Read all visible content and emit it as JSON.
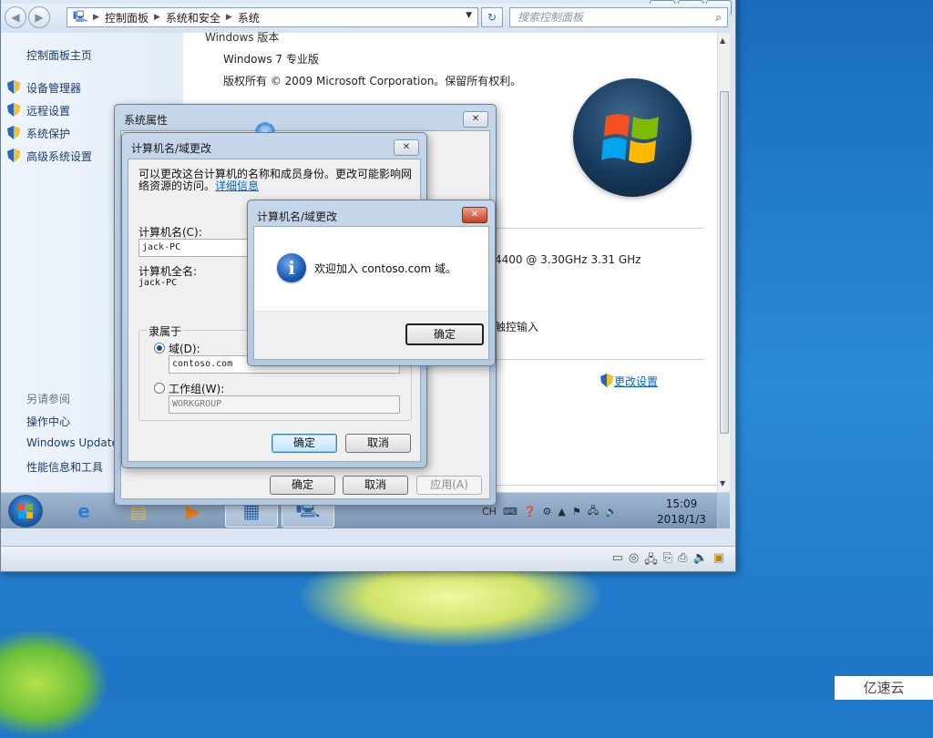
{
  "desktop": {
    "watermark": "亿速云"
  },
  "vm_window": {
    "caption_min": "▭",
    "caption_restore": "⧉",
    "caption_close": "✕"
  },
  "explorer": {
    "breadcrumb": [
      "控制面板",
      "系统和安全",
      "系统"
    ],
    "search_placeholder": "搜索控制面板",
    "left_pane": {
      "home": "控制面板主页",
      "tasks": [
        "设备管理器",
        "远程设置",
        "系统保护",
        "高级系统设置"
      ],
      "see_also_heading": "另请参阅",
      "see_also": [
        "操作中心",
        "Windows Update",
        "性能信息和工具"
      ]
    },
    "main": {
      "edition_heading": "Windows 版本",
      "edition": "Windows 7 专业版",
      "copyright": "版权所有 © 2009 Microsoft Corporation。保留所有权利。",
      "processor_speed": "4400 @ 3.30GHz   3.31 GHz",
      "pen_touch": "触控输入",
      "change_settings": "更改设置"
    }
  },
  "taskbar": {
    "tray_lang": "CH",
    "clock_time": "15:09",
    "clock_date": "2018/1/3"
  },
  "system_properties": {
    "title": "系统属性",
    "ok": "确定",
    "cancel": "取消",
    "apply": "应用(A)"
  },
  "computer_name_dialog": {
    "title": "计算机名/域更改",
    "description": "可以更改这台计算机的名称和成员身份。更改可能影响网络资源的访问。",
    "more_info": "详细信息",
    "computer_name_label": "计算机名(C):",
    "computer_name_value": "jack-PC",
    "full_name_label": "计算机全名:",
    "full_name_value": "jack-PC",
    "member_of": "隶属于",
    "domain_label": "域(D):",
    "domain_value": "contoso.com",
    "workgroup_label": "工作组(W):",
    "workgroup_value": "WORKGROUP",
    "ok": "确定",
    "cancel": "取消"
  },
  "message_box": {
    "title": "计算机名/域更改",
    "message": "欢迎加入 contoso.com 域。",
    "ok": "确定"
  }
}
